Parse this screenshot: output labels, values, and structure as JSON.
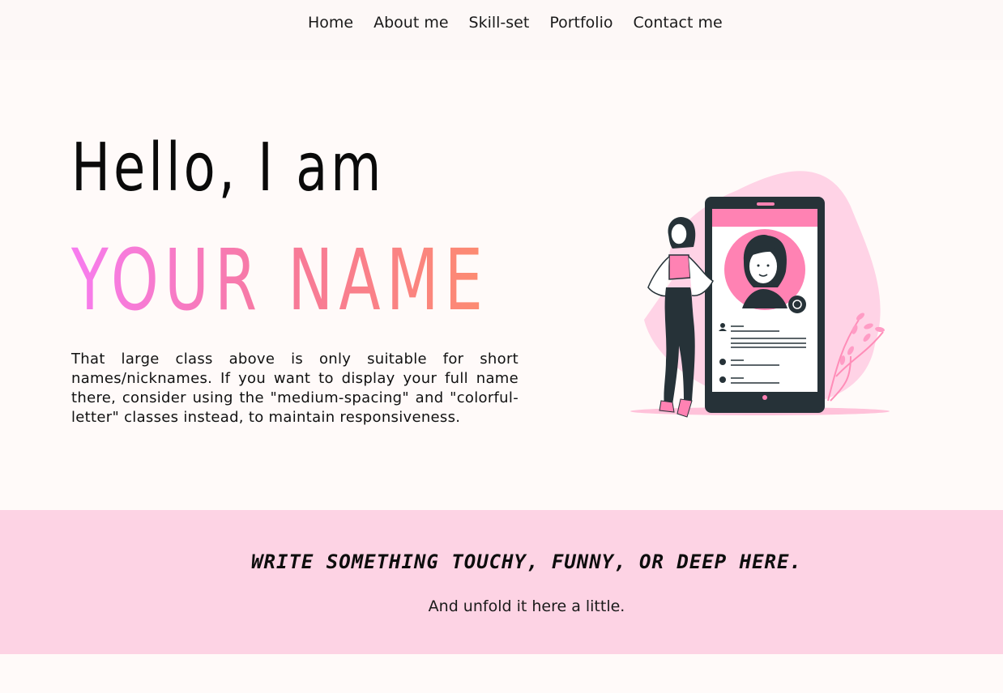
{
  "nav": {
    "items": [
      {
        "label": "Home"
      },
      {
        "label": "About me"
      },
      {
        "label": "Skill-set"
      },
      {
        "label": "Portfolio"
      },
      {
        "label": "Contact me"
      }
    ]
  },
  "hero": {
    "greeting": "Hello, I am",
    "name": "YOUR NAME",
    "description": "That large class above is only suitable for short names/nicknames. If you want to display your full name there, consider using the \"medium-spacing\" and \"colorful-letter\" classes instead, to maintain responsiveness."
  },
  "quote": {
    "title": "WRITE SOMETHING TOUCHY, FUNNY, OR DEEP HERE.",
    "subtitle": "And unfold it here a little."
  },
  "colors": {
    "background": "#fffaf9",
    "accent_pink": "#ff7eb3",
    "band": "#fdd3e4",
    "dark": "#263238"
  }
}
